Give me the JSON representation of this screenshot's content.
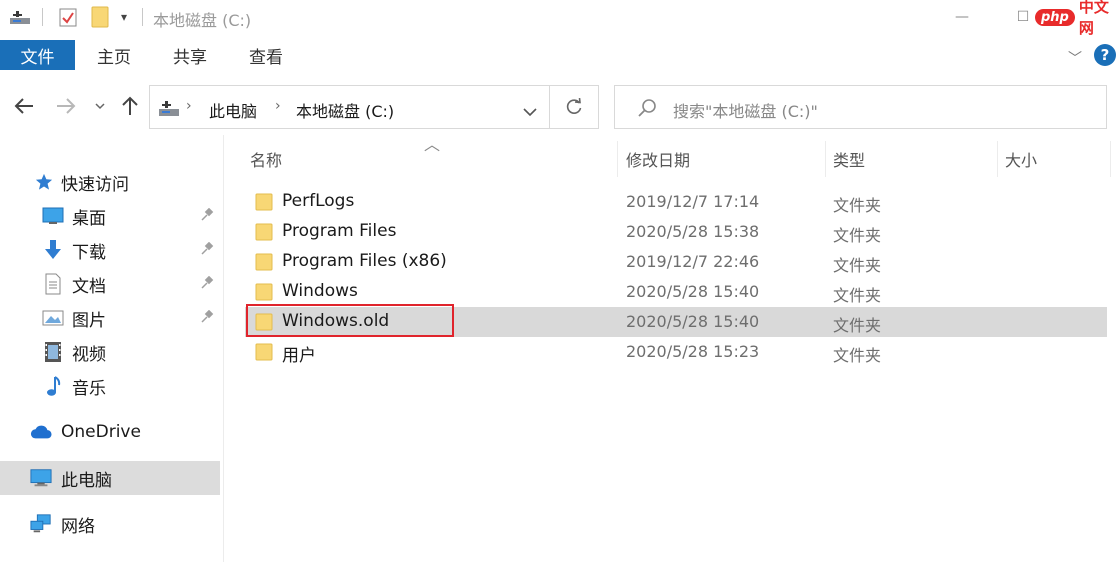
{
  "window": {
    "title": "本地磁盘 (C:)",
    "minimize_glyph": "—",
    "maximize_glyph": "☐"
  },
  "watermark": {
    "badge": "php",
    "text": "中文网"
  },
  "ribbon": {
    "tabs": [
      "文件",
      "主页",
      "共享",
      "查看"
    ],
    "accent_color": "#1a6fb8",
    "help_glyph": "?"
  },
  "address_bar": {
    "breadcrumbs": [
      "此电脑",
      "本地磁盘 (C:)"
    ],
    "search_placeholder": "搜索\"本地磁盘 (C:)\""
  },
  "nav_pane": {
    "items": [
      {
        "label": "快速访问",
        "icon": "star-icon",
        "pinned": false
      },
      {
        "label": "桌面",
        "icon": "desktop-icon",
        "pinned": true
      },
      {
        "label": "下载",
        "icon": "download-icon",
        "pinned": true
      },
      {
        "label": "文档",
        "icon": "document-icon",
        "pinned": true
      },
      {
        "label": "图片",
        "icon": "picture-icon",
        "pinned": true
      },
      {
        "label": "视频",
        "icon": "video-icon",
        "pinned": false
      },
      {
        "label": "音乐",
        "icon": "music-icon",
        "pinned": false
      },
      {
        "label": "OneDrive",
        "icon": "cloud-icon",
        "pinned": false
      },
      {
        "label": "此电脑",
        "icon": "computer-icon",
        "pinned": false,
        "selected": true
      },
      {
        "label": "网络",
        "icon": "network-icon",
        "pinned": false
      }
    ]
  },
  "file_list": {
    "columns": [
      "名称",
      "修改日期",
      "类型",
      "大小"
    ],
    "rows": [
      {
        "name": "PerfLogs",
        "modified": "2019/12/7 17:14",
        "type": "文件夹"
      },
      {
        "name": "Program Files",
        "modified": "2020/5/28 15:38",
        "type": "文件夹"
      },
      {
        "name": "Program Files (x86)",
        "modified": "2019/12/7 22:46",
        "type": "文件夹"
      },
      {
        "name": "Windows",
        "modified": "2020/5/28 15:40",
        "type": "文件夹"
      },
      {
        "name": "Windows.old",
        "modified": "2020/5/28 15:40",
        "type": "文件夹",
        "selected": true,
        "highlighted": true
      },
      {
        "name": "用户",
        "modified": "2020/5/28 15:23",
        "type": "文件夹"
      }
    ],
    "highlight_color": "#e0242c"
  }
}
